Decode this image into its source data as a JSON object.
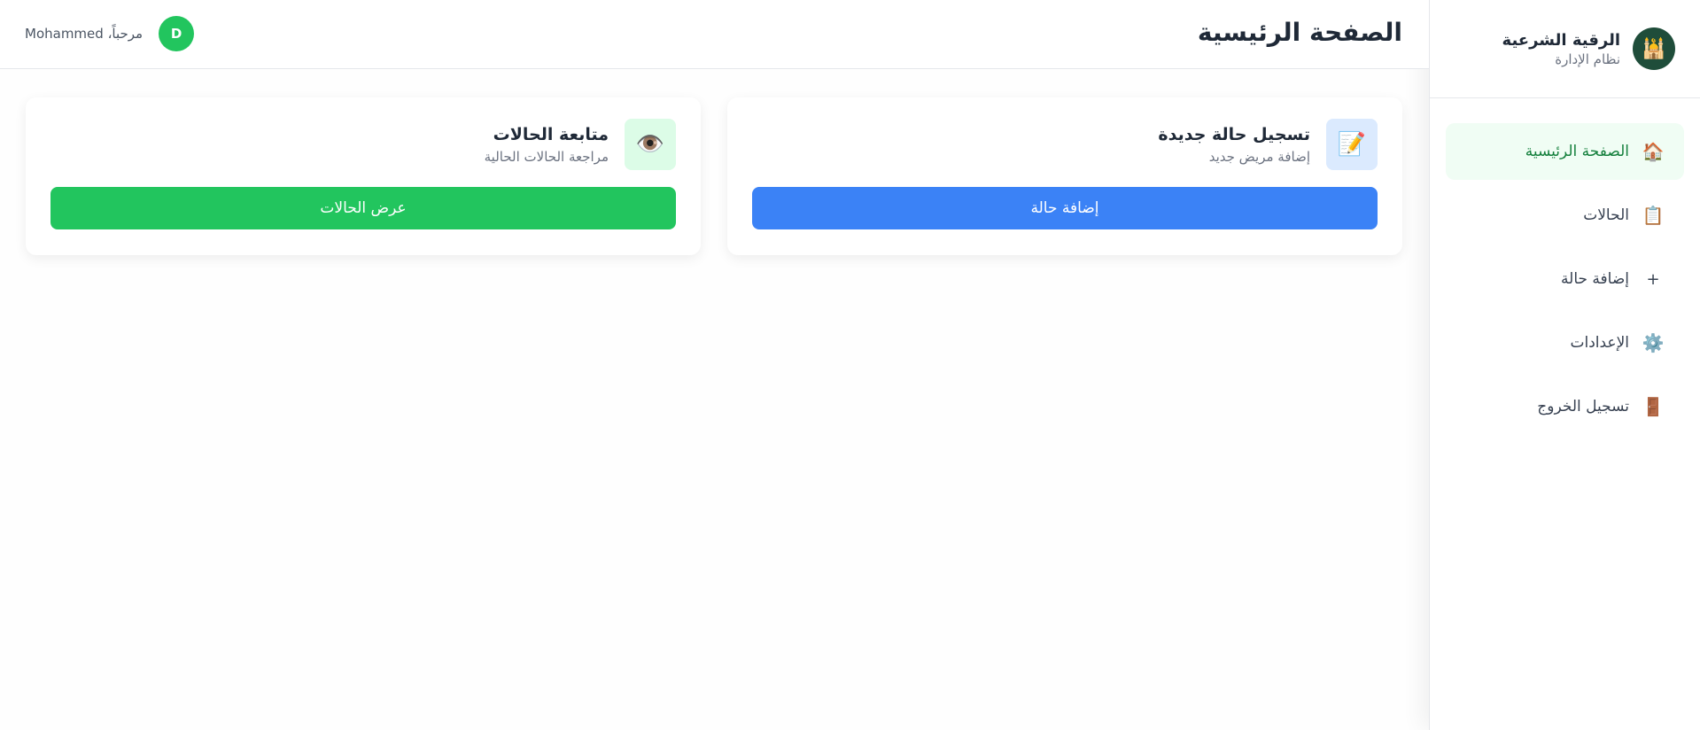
{
  "brand": {
    "title": "الرقية الشرعية",
    "subtitle": "نظام الإدارة",
    "logo_icon": "🕌"
  },
  "sidebar": {
    "items": [
      {
        "label": "الصفحة الرئيسية",
        "icon": "🏠",
        "icon_name": "home-icon",
        "active": true
      },
      {
        "label": "الحالات",
        "icon": "📋",
        "icon_name": "clipboard-icon",
        "active": false
      },
      {
        "label": "إضافة حالة",
        "icon": "+",
        "icon_name": "plus-icon",
        "active": false
      },
      {
        "label": "الإعدادات",
        "icon": "⚙️",
        "icon_name": "gear-icon",
        "active": false
      },
      {
        "label": "تسجيل الخروج",
        "icon": "🚪",
        "icon_name": "door-icon",
        "active": false
      }
    ]
  },
  "header": {
    "title": "الصفحة الرئيسية",
    "greeting": "مرحباً، Mohammed",
    "avatar_letter": "D"
  },
  "cards": [
    {
      "title": "تسجيل حالة جديدة",
      "subtitle": "إضافة مريض جديد",
      "icon": "📝",
      "icon_name": "memo-icon",
      "button": "إضافة حالة",
      "color": "#3b82f6"
    },
    {
      "title": "متابعة الحالات",
      "subtitle": "مراجعة الحالات الحالية",
      "icon": "👁️",
      "icon_name": "eye-icon",
      "button": "عرض الحالات",
      "color": "#22c55e"
    }
  ],
  "colors": {
    "primary_green": "#22c55e",
    "primary_blue": "#3b82f6",
    "active_bg": "#f0fdf4",
    "active_text": "#15803d",
    "logo_bg": "#1f4d3a"
  }
}
